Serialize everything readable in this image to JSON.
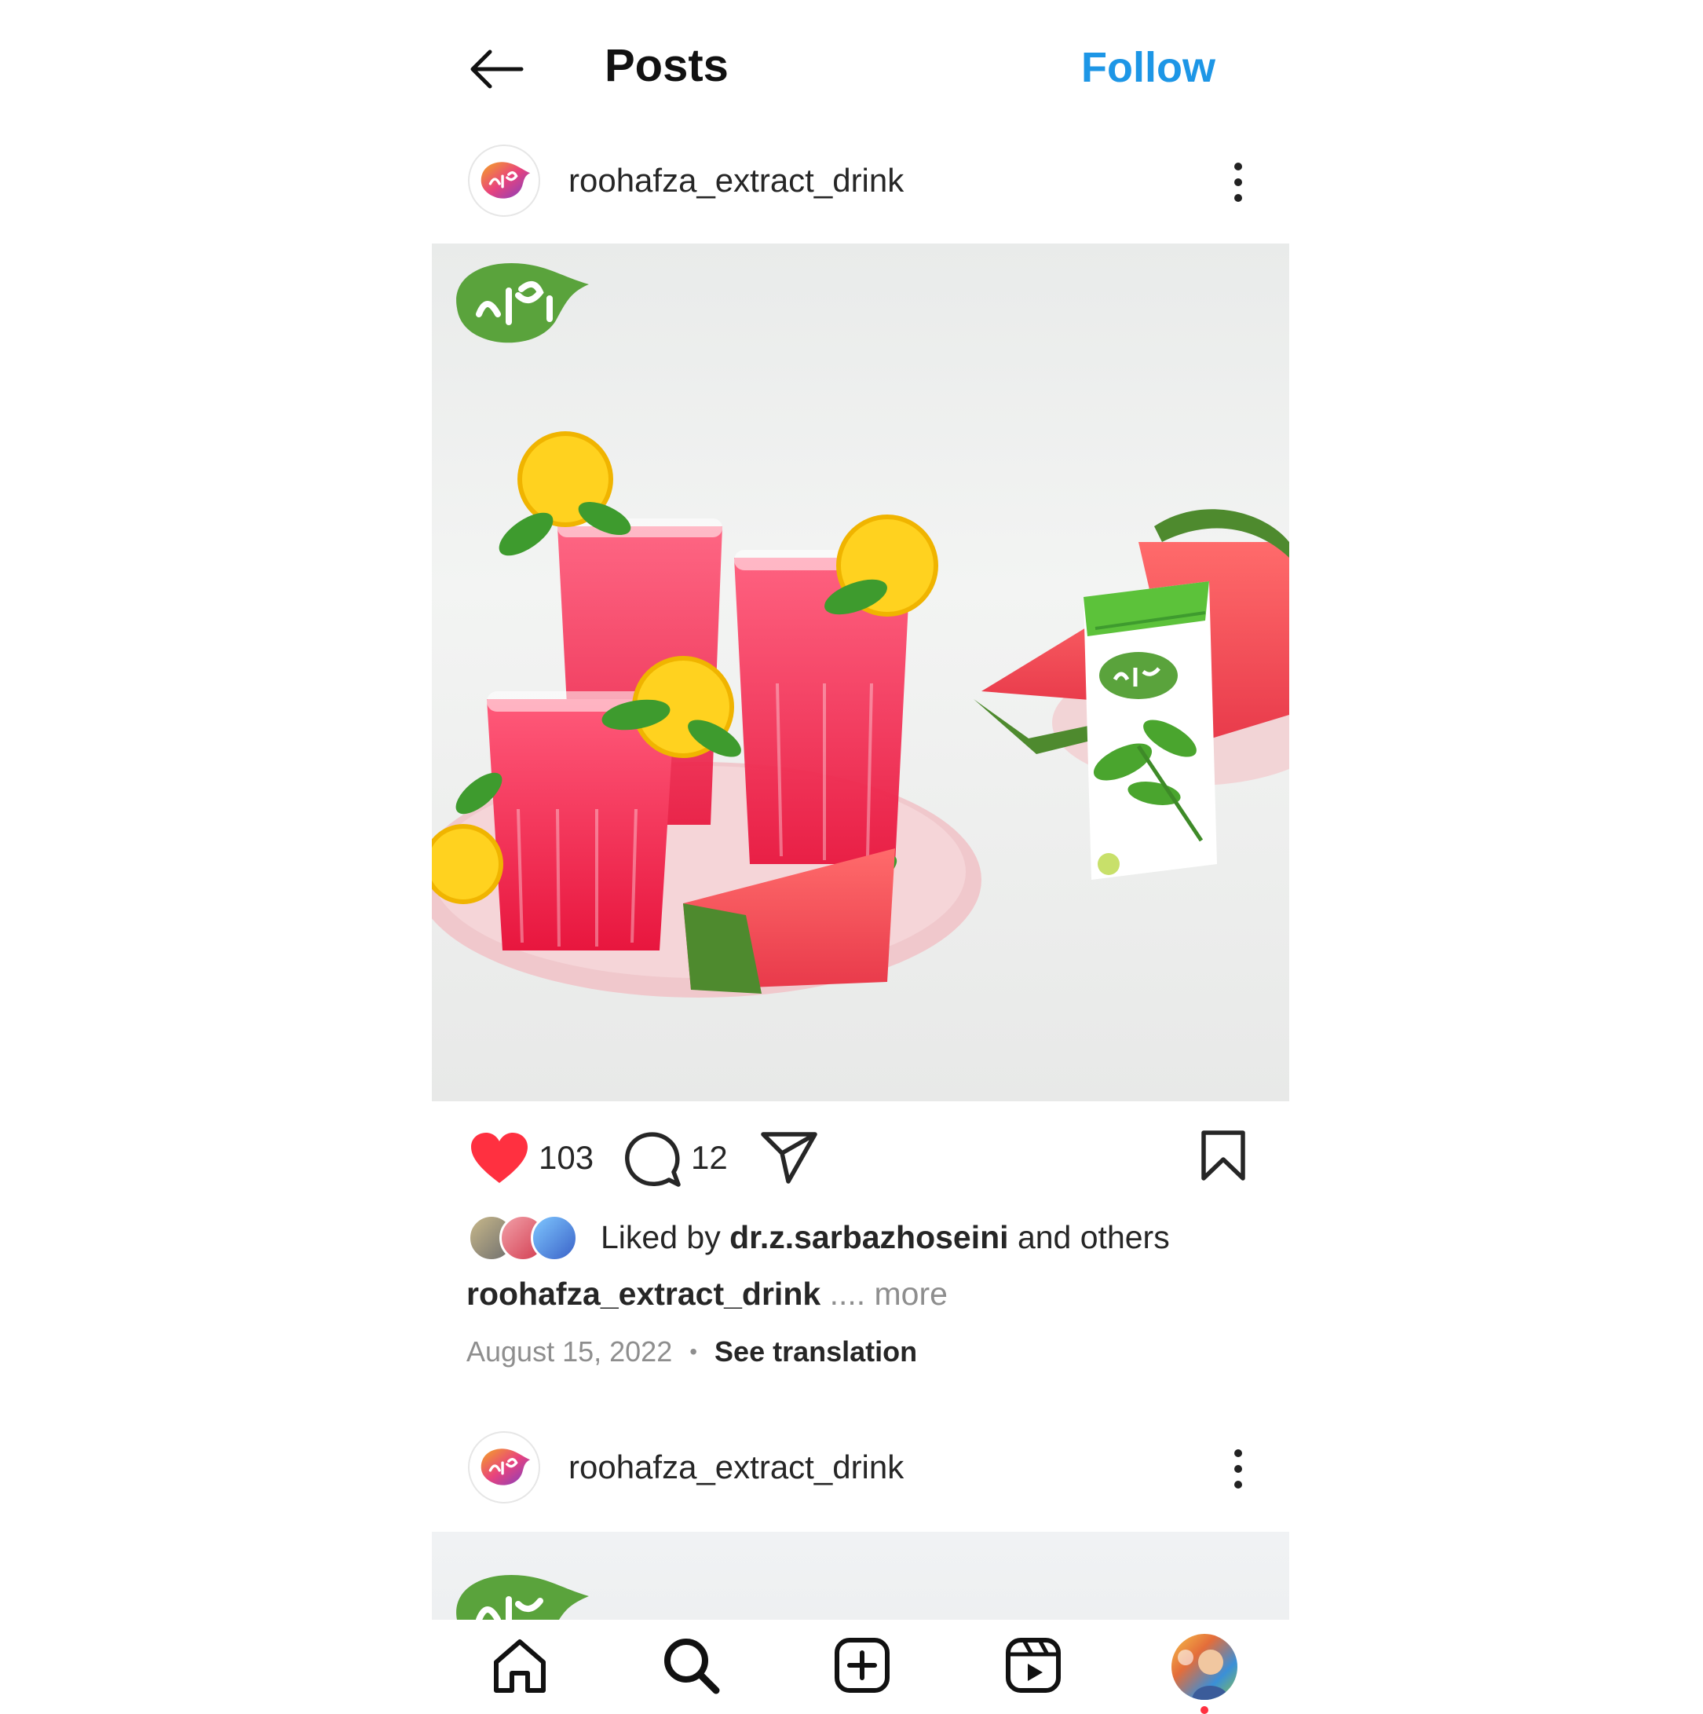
{
  "header": {
    "title": "Posts",
    "follow_label": "Follow"
  },
  "posts": [
    {
      "username": "roohafza_extract_drink",
      "likes": "103",
      "comments": "12",
      "liked_by_prefix": "Liked by ",
      "liked_by_user": "dr.z.sarbazhoseini",
      "liked_by_suffix": " and others",
      "caption_user": "roohafza_extract_drink",
      "caption_more": " .... more",
      "date": "August 15, 2022",
      "separator": "•",
      "see_translation": "See translation"
    },
    {
      "username": "roohafza_extract_drink"
    }
  ],
  "bottom_nav": {
    "items": [
      "home-icon",
      "search-icon",
      "create-icon",
      "reels-icon",
      "profile-avatar"
    ]
  },
  "colors": {
    "follow": "#1d96e6",
    "like": "#ff3040",
    "brand_green": "#5aa33c"
  }
}
